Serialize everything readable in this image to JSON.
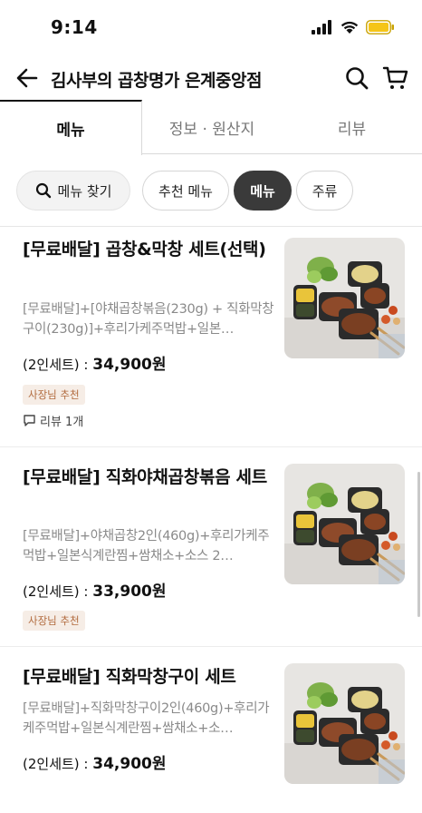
{
  "status": {
    "time": "9:14"
  },
  "header": {
    "title": "김사부의 곱창명가 은계중앙점",
    "back_icon": "arrow-left-icon",
    "search_icon": "search-icon",
    "cart_icon": "cart-icon"
  },
  "tabs": [
    {
      "label": "메뉴",
      "active": true
    },
    {
      "label": "정보 · 원산지",
      "active": false
    },
    {
      "label": "리뷰",
      "active": false
    }
  ],
  "chips": {
    "search_label": "메뉴 찾기",
    "items": [
      {
        "label": "추천 메뉴",
        "selected": false
      },
      {
        "label": "메뉴",
        "selected": true
      },
      {
        "label": "주류",
        "selected": false
      }
    ]
  },
  "menu": [
    {
      "name": "[무료배달] 곱창&막창 세트(선택)",
      "desc": "[무료배달]+[야채곱창볶음(230g) + 직화막창구이(230g)]+후리가케주먹밥+일본…",
      "serving": "(2인세트) :",
      "price": "34,900원",
      "badge": "사장님 추천",
      "review": "리뷰 1개"
    },
    {
      "name": "[무료배달] 직화야채곱창볶음 세트",
      "desc": "[무료배달]+야채곱창2인(460g)+후리가케주먹밥+일본식계란찜+쌈채소+소스 2…",
      "serving": "(2인세트) :",
      "price": "33,900원",
      "badge": "사장님 추천"
    },
    {
      "name": "[무료배달] 직화막창구이 세트",
      "desc": "[무료배달]+직화막창구이2인(460g)+후리가케주먹밥+일본식계란찜+쌈채소+소…",
      "serving": "(2인세트) :",
      "price": "34,900원"
    }
  ],
  "colors": {
    "accent_dark": "#3a3a3a",
    "badge_bg": "#f6ede6",
    "badge_text": "#b26b3e",
    "battery": "#f5c518"
  }
}
